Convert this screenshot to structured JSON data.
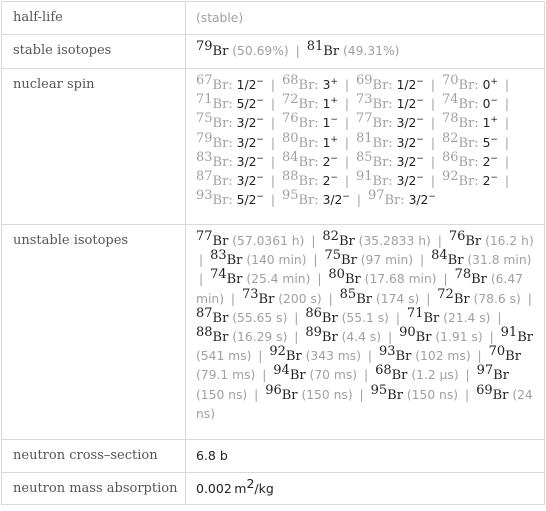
{
  "rows": {
    "half_life": {
      "label": "half-life",
      "value": "(stable)"
    },
    "stable_isotopes": {
      "label": "stable isotopes",
      "items": [
        {
          "mass": "79",
          "symbol": "Br",
          "abundance": "(50.69%)"
        },
        {
          "mass": "81",
          "symbol": "Br",
          "abundance": "(49.31%)"
        }
      ]
    },
    "nuclear_spin": {
      "label": "nuclear spin",
      "items": [
        {
          "mass": "67",
          "symbol": "Br:",
          "spin": "1/2",
          "parity": "−"
        },
        {
          "mass": "68",
          "symbol": "Br:",
          "spin": "3",
          "parity": "+"
        },
        {
          "mass": "69",
          "symbol": "Br:",
          "spin": "1/2",
          "parity": "−"
        },
        {
          "mass": "70",
          "symbol": "Br:",
          "spin": "0",
          "parity": "+"
        },
        {
          "mass": "71",
          "symbol": "Br:",
          "spin": "5/2",
          "parity": "−"
        },
        {
          "mass": "72",
          "symbol": "Br:",
          "spin": "1",
          "parity": "+"
        },
        {
          "mass": "73",
          "symbol": "Br:",
          "spin": "1/2",
          "parity": "−"
        },
        {
          "mass": "74",
          "symbol": "Br:",
          "spin": "0",
          "parity": "−"
        },
        {
          "mass": "75",
          "symbol": "Br:",
          "spin": "3/2",
          "parity": "−"
        },
        {
          "mass": "76",
          "symbol": "Br:",
          "spin": "1",
          "parity": "−"
        },
        {
          "mass": "77",
          "symbol": "Br:",
          "spin": "3/2",
          "parity": "−"
        },
        {
          "mass": "78",
          "symbol": "Br:",
          "spin": "1",
          "parity": "+"
        },
        {
          "mass": "79",
          "symbol": "Br:",
          "spin": "3/2",
          "parity": "−"
        },
        {
          "mass": "80",
          "symbol": "Br:",
          "spin": "1",
          "parity": "+"
        },
        {
          "mass": "81",
          "symbol": "Br:",
          "spin": "3/2",
          "parity": "−"
        },
        {
          "mass": "82",
          "symbol": "Br:",
          "spin": "5",
          "parity": "−"
        },
        {
          "mass": "83",
          "symbol": "Br:",
          "spin": "3/2",
          "parity": "−"
        },
        {
          "mass": "84",
          "symbol": "Br:",
          "spin": "2",
          "parity": "−"
        },
        {
          "mass": "85",
          "symbol": "Br:",
          "spin": "3/2",
          "parity": "−"
        },
        {
          "mass": "86",
          "symbol": "Br:",
          "spin": "2",
          "parity": "−"
        },
        {
          "mass": "87",
          "symbol": "Br:",
          "spin": "3/2",
          "parity": "−"
        },
        {
          "mass": "88",
          "symbol": "Br:",
          "spin": "2",
          "parity": "−"
        },
        {
          "mass": "91",
          "symbol": "Br:",
          "spin": "3/2",
          "parity": "−"
        },
        {
          "mass": "92",
          "symbol": "Br:",
          "spin": "2",
          "parity": "−"
        },
        {
          "mass": "93",
          "symbol": "Br:",
          "spin": "5/2",
          "parity": "−"
        },
        {
          "mass": "95",
          "symbol": "Br:",
          "spin": "3/2",
          "parity": "−"
        },
        {
          "mass": "97",
          "symbol": "Br:",
          "spin": "3/2",
          "parity": "−"
        }
      ]
    },
    "unstable_isotopes": {
      "label": "unstable isotopes",
      "items": [
        {
          "mass": "77",
          "symbol": "Br",
          "half_life": "(57.0361 h)"
        },
        {
          "mass": "82",
          "symbol": "Br",
          "half_life": "(35.2833 h)"
        },
        {
          "mass": "76",
          "symbol": "Br",
          "half_life": "(16.2 h)"
        },
        {
          "mass": "83",
          "symbol": "Br",
          "half_life": "(140 min)"
        },
        {
          "mass": "75",
          "symbol": "Br",
          "half_life": "(97 min)"
        },
        {
          "mass": "84",
          "symbol": "Br",
          "half_life": "(31.8 min)"
        },
        {
          "mass": "74",
          "symbol": "Br",
          "half_life": "(25.4 min)"
        },
        {
          "mass": "80",
          "symbol": "Br",
          "half_life": "(17.68 min)"
        },
        {
          "mass": "78",
          "symbol": "Br",
          "half_life": "(6.47 min)"
        },
        {
          "mass": "73",
          "symbol": "Br",
          "half_life": "(200 s)"
        },
        {
          "mass": "85",
          "symbol": "Br",
          "half_life": "(174 s)"
        },
        {
          "mass": "72",
          "symbol": "Br",
          "half_life": "(78.6 s)"
        },
        {
          "mass": "87",
          "symbol": "Br",
          "half_life": "(55.65 s)"
        },
        {
          "mass": "86",
          "symbol": "Br",
          "half_life": "(55.1 s)"
        },
        {
          "mass": "71",
          "symbol": "Br",
          "half_life": "(21.4 s)"
        },
        {
          "mass": "88",
          "symbol": "Br",
          "half_life": "(16.29 s)"
        },
        {
          "mass": "89",
          "symbol": "Br",
          "half_life": "(4.4 s)"
        },
        {
          "mass": "90",
          "symbol": "Br",
          "half_life": "(1.91 s)"
        },
        {
          "mass": "91",
          "symbol": "Br",
          "half_life": "(541 ms)"
        },
        {
          "mass": "92",
          "symbol": "Br",
          "half_life": "(343 ms)"
        },
        {
          "mass": "93",
          "symbol": "Br",
          "half_life": "(102 ms)"
        },
        {
          "mass": "70",
          "symbol": "Br",
          "half_life": "(79.1 ms)"
        },
        {
          "mass": "94",
          "symbol": "Br",
          "half_life": "(70 ms)"
        },
        {
          "mass": "68",
          "symbol": "Br",
          "half_life": "(1.2 µs)"
        },
        {
          "mass": "97",
          "symbol": "Br",
          "half_life": "(150 ns)"
        },
        {
          "mass": "96",
          "symbol": "Br",
          "half_life": "(150 ns)"
        },
        {
          "mass": "95",
          "symbol": "Br",
          "half_life": "(150 ns)"
        },
        {
          "mass": "69",
          "symbol": "Br",
          "half_life": "(24 ns)"
        }
      ]
    },
    "neutron_cross_section": {
      "label": "neutron cross–section",
      "value": "6.8 b"
    },
    "neutron_mass_absorption": {
      "label": "neutron mass absorption",
      "value_number": "0.002",
      "value_unit": "m",
      "value_exp": "2",
      "value_unit_tail": "/kg"
    }
  },
  "separator": "|"
}
